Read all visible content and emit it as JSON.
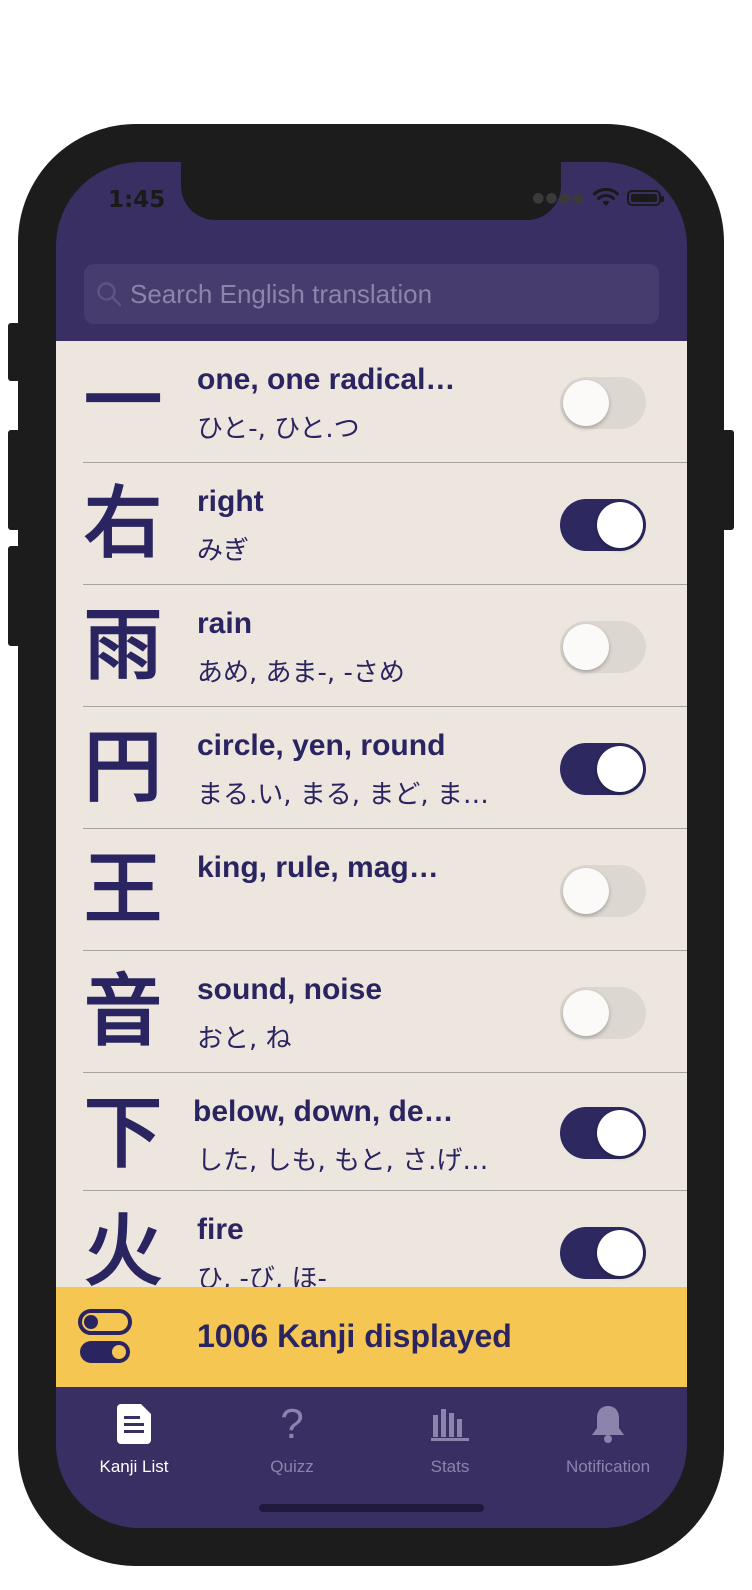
{
  "status_bar": {
    "time": "1:45"
  },
  "search": {
    "placeholder": "Search English translation"
  },
  "kanji_list": [
    {
      "kanji": "一",
      "meaning": "one, one radical…",
      "reading": "ひと-, ひと.つ",
      "enabled": false
    },
    {
      "kanji": "右",
      "meaning": "right",
      "reading": "みぎ",
      "enabled": true
    },
    {
      "kanji": "雨",
      "meaning": "rain",
      "reading": "あめ, あま-, -さめ",
      "enabled": false
    },
    {
      "kanji": "円",
      "meaning": "circle, yen, round",
      "reading": "まる.い, まる, まど, ま…",
      "enabled": true
    },
    {
      "kanji": "王",
      "meaning": "king, rule, mag…",
      "reading": "",
      "enabled": false
    },
    {
      "kanji": "音",
      "meaning": "sound, noise",
      "reading": "おと, ね",
      "enabled": false
    },
    {
      "kanji": "下",
      "meaning": "below, down, de…",
      "reading": "した, しも, もと, さ.げ…",
      "enabled": true
    },
    {
      "kanji": "火",
      "meaning": "fire",
      "reading": "ひ, -び, ほ-",
      "enabled": true
    }
  ],
  "banner": {
    "text": "1006 Kanji displayed"
  },
  "tabs": [
    {
      "label": "Kanji List",
      "icon": "document-icon",
      "active": true
    },
    {
      "label": "Quizz",
      "icon": "question-icon",
      "active": false
    },
    {
      "label": "Stats",
      "icon": "bar-chart-icon",
      "active": false
    },
    {
      "label": "Notification",
      "icon": "bell-icon",
      "active": false
    }
  ],
  "colors": {
    "primary": "#392f63",
    "list_bg": "#ece6de",
    "text": "#2a2460",
    "banner": "#f6c652",
    "toggle_on": "#2d2860",
    "toggle_off": "#dcd7d0"
  }
}
